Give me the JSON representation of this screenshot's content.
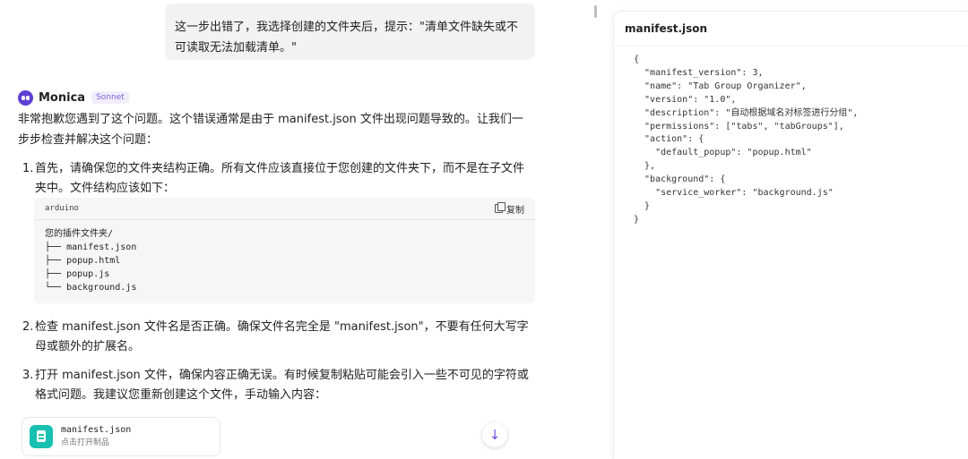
{
  "user_message": "这一步出错了，我选择创建的文件夹后，提示：\"清单文件缺失或不可读取无法加载清单。\"",
  "assistant": {
    "name": "Monica",
    "model": "Sonnet",
    "intro": "非常抱歉您遇到了这个问题。这个错误通常是由于 manifest.json 文件出现问题导致的。让我们一步步检查并解决这个问题：",
    "steps": [
      {
        "num": "1.",
        "text": "首先，请确保您的文件夹结构正确。所有文件应该直接位于您创建的文件夹下，而不是在子文件夹中。文件结构应该如下："
      },
      {
        "num": "2.",
        "text": "检查 manifest.json 文件名是否正确。确保文件名完全是 \"manifest.json\"，不要有任何大写字母或额外的扩展名。"
      },
      {
        "num": "3.",
        "text": "打开 manifest.json 文件，确保内容正确无误。有时候复制粘贴可能会引入一些不可见的字符或格式问题。我建议您重新创建这个文件，手动输入内容："
      }
    ],
    "code_block": {
      "lang": "arduino",
      "copy_label": "复制",
      "content": "您的插件文件夹/\n├── manifest.json\n├── popup.html\n├── popup.js\n└── background.js"
    },
    "file_card": {
      "name": "manifest.json",
      "subtitle": "点击打开制品"
    }
  },
  "panel": {
    "title": "manifest.json",
    "code_lines": [
      "{",
      "  \"manifest_version\": 3,",
      "  \"name\": \"Tab Group Organizer\",",
      "  \"version\": \"1.0\",",
      "  \"description\": \"自动根据域名对标签进行分组\",",
      "  \"permissions\": [\"tabs\", \"tabGroups\"],",
      "  \"action\": {",
      "    \"default_popup\": \"popup.html\"",
      "  },",
      "  \"background\": {",
      "    \"service_worker\": \"background.js\"",
      "  }",
      "}"
    ]
  },
  "icons": {
    "avatar": "monica-avatar-icon",
    "copy": "copy-icon",
    "file": "file-icon",
    "scroll": "arrow-down-icon"
  },
  "colors": {
    "accent": "#6b4fe0",
    "file_icon": "#17c0b0",
    "user_bubble": "#f2f2f3",
    "code_bg": "#f6f6f7"
  }
}
